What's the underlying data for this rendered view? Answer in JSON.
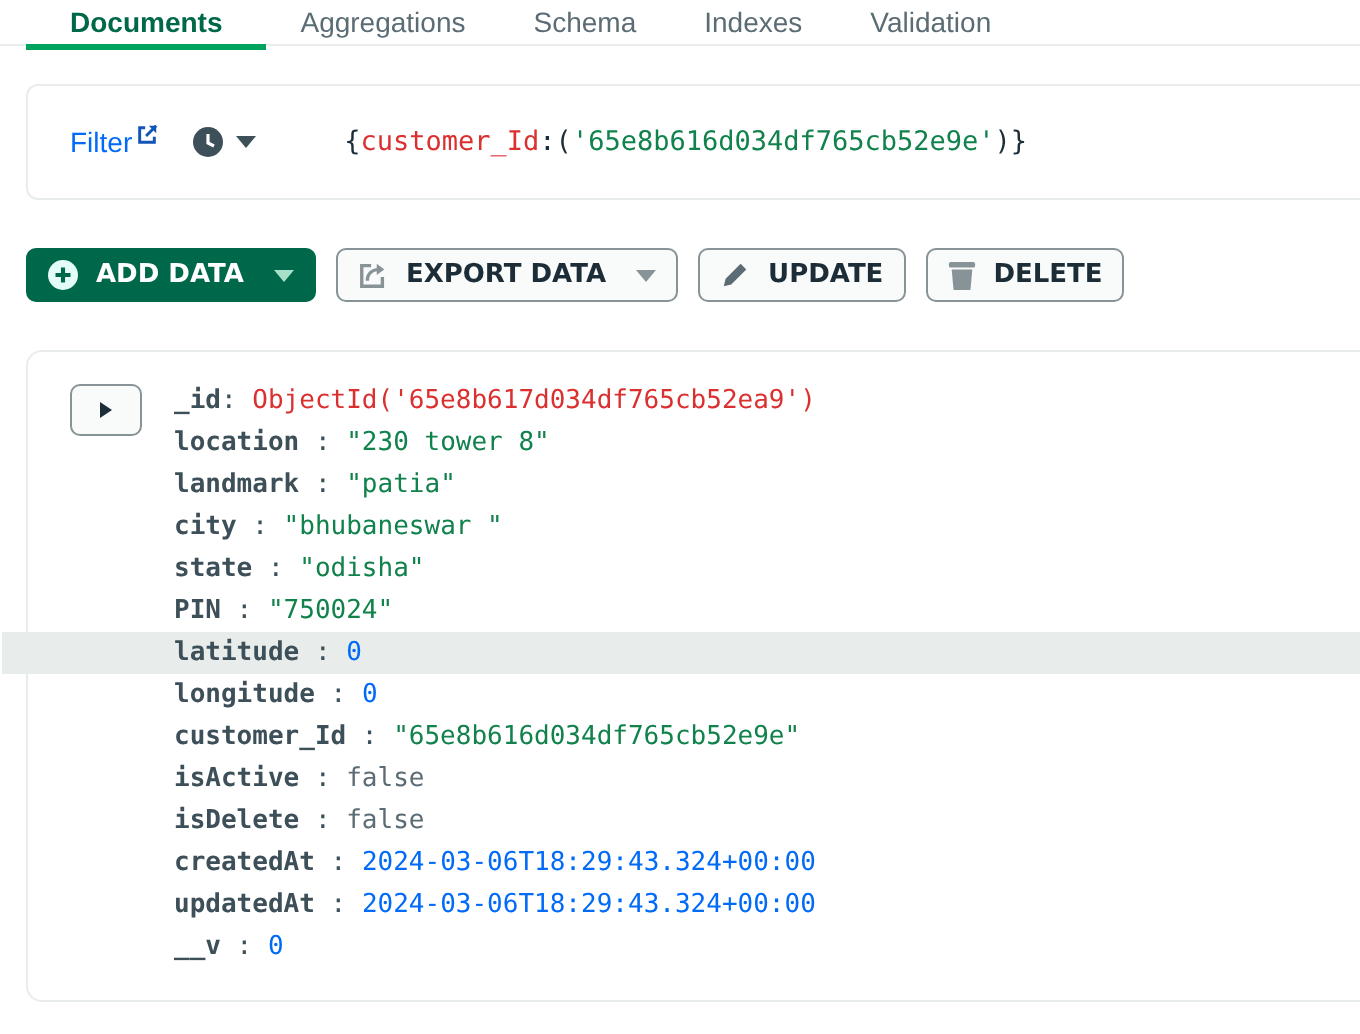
{
  "tabs": [
    {
      "label": "Documents",
      "selected": true
    },
    {
      "label": "Aggregations",
      "selected": false
    },
    {
      "label": "Schema",
      "selected": false
    },
    {
      "label": "Indexes",
      "selected": false
    },
    {
      "label": "Validation",
      "selected": false
    }
  ],
  "filter": {
    "label": "Filter",
    "query_open": "{",
    "query_key": "customer_Id",
    "query_colon": ":(",
    "query_value": "'65e8b616d034df765cb52e9e'",
    "query_close": ")}"
  },
  "toolbar": [
    {
      "kind": "primary",
      "label": "ADD DATA",
      "dropdown": true
    },
    {
      "kind": "secondary",
      "label": "EXPORT DATA",
      "dropdown": true
    },
    {
      "kind": "secondary",
      "label": "UPDATE",
      "dropdown": false
    },
    {
      "kind": "secondary",
      "label": "DELETE",
      "dropdown": false
    }
  ],
  "document": {
    "expanded": false,
    "fields": [
      {
        "key": "_id",
        "separator": ": ",
        "value": "ObjectId('65e8b617d034df765cb52ea9')",
        "kind": "objectid",
        "highlighted": false
      },
      {
        "key": "location",
        "separator": " : ",
        "value": "\"230 tower 8\"",
        "kind": "string",
        "highlighted": false
      },
      {
        "key": "landmark",
        "separator": " : ",
        "value": "\"patia\"",
        "kind": "string",
        "highlighted": false
      },
      {
        "key": "city",
        "separator": " : ",
        "value": "\"bhubaneswar \"",
        "kind": "string",
        "highlighted": false
      },
      {
        "key": "state",
        "separator": " : ",
        "value": "\"odisha\"",
        "kind": "string",
        "highlighted": false
      },
      {
        "key": "PIN",
        "separator": " : ",
        "value": "\"750024\"",
        "kind": "string",
        "highlighted": false
      },
      {
        "key": "latitude",
        "separator": " : ",
        "value": "0",
        "kind": "number",
        "highlighted": true
      },
      {
        "key": "longitude",
        "separator": " : ",
        "value": "0",
        "kind": "number",
        "highlighted": false
      },
      {
        "key": "customer_Id",
        "separator": " : ",
        "value": "\"65e8b616d034df765cb52e9e\"",
        "kind": "string",
        "highlighted": false
      },
      {
        "key": "isActive",
        "separator": " : ",
        "value": "false",
        "kind": "boolean",
        "highlighted": false
      },
      {
        "key": "isDelete",
        "separator": " : ",
        "value": "false",
        "kind": "boolean",
        "highlighted": false
      },
      {
        "key": "createdAt",
        "separator": " : ",
        "value": "2024-03-06T18:29:43.324+00:00",
        "kind": "date",
        "highlighted": false
      },
      {
        "key": "updatedAt",
        "separator": " : ",
        "value": "2024-03-06T18:29:43.324+00:00",
        "kind": "date",
        "highlighted": false
      },
      {
        "key": "__v",
        "separator": " : ",
        "value": "0",
        "kind": "number",
        "highlighted": false
      }
    ]
  }
}
